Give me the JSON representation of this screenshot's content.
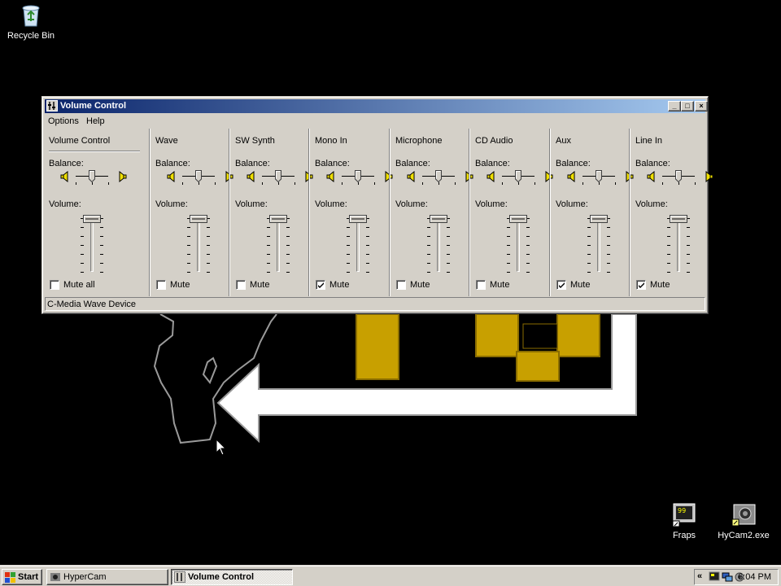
{
  "desktop": {
    "icons": [
      {
        "label": "Recycle Bin",
        "icon": "recycle-bin-icon"
      },
      {
        "label": "Fraps",
        "icon": "fraps-icon",
        "badge": "99"
      },
      {
        "label": "HyCam2.exe",
        "icon": "hypercam-icon"
      }
    ]
  },
  "window": {
    "title": "Volume Control",
    "controls": {
      "minimize": "_",
      "maximize": "□",
      "close": "×"
    },
    "menu": [
      "Options",
      "Help"
    ],
    "balance_label": "Balance:",
    "volume_label": "Volume:",
    "status": "C-Media Wave Device",
    "channels": [
      {
        "name": "Volume Control",
        "mute_label": "Mute all",
        "muted": false,
        "balance": 0.5,
        "volume": 1.0
      },
      {
        "name": "Wave",
        "mute_label": "Mute",
        "muted": false,
        "balance": 0.5,
        "volume": 1.0
      },
      {
        "name": "SW Synth",
        "mute_label": "Mute",
        "muted": false,
        "balance": 0.5,
        "volume": 1.0
      },
      {
        "name": "Mono In",
        "mute_label": "Mute",
        "muted": true,
        "balance": 0.5,
        "volume": 1.0
      },
      {
        "name": "Microphone",
        "mute_label": "Mute",
        "muted": false,
        "balance": 0.5,
        "volume": 1.0
      },
      {
        "name": "CD Audio",
        "mute_label": "Mute",
        "muted": false,
        "balance": 0.5,
        "volume": 1.0
      },
      {
        "name": "Aux",
        "mute_label": "Mute",
        "muted": true,
        "balance": 0.5,
        "volume": 1.0
      },
      {
        "name": "Line In",
        "mute_label": "Mute",
        "muted": true,
        "balance": 0.5,
        "volume": 1.0
      }
    ]
  },
  "taskbar": {
    "start_label": "Start",
    "tasks": [
      {
        "label": "HyperCam",
        "active": false
      },
      {
        "label": "Volume Control",
        "active": true
      }
    ],
    "tray": {
      "chevron": "«",
      "clock": "6:04 PM"
    }
  },
  "colors": {
    "desktop": "#000000",
    "face": "#d4d0c8",
    "title_start": "#0a246a",
    "title_end": "#a6caf0",
    "wallpaper_gold": "#c8a000",
    "wallpaper_arrow": "#ffffff"
  }
}
